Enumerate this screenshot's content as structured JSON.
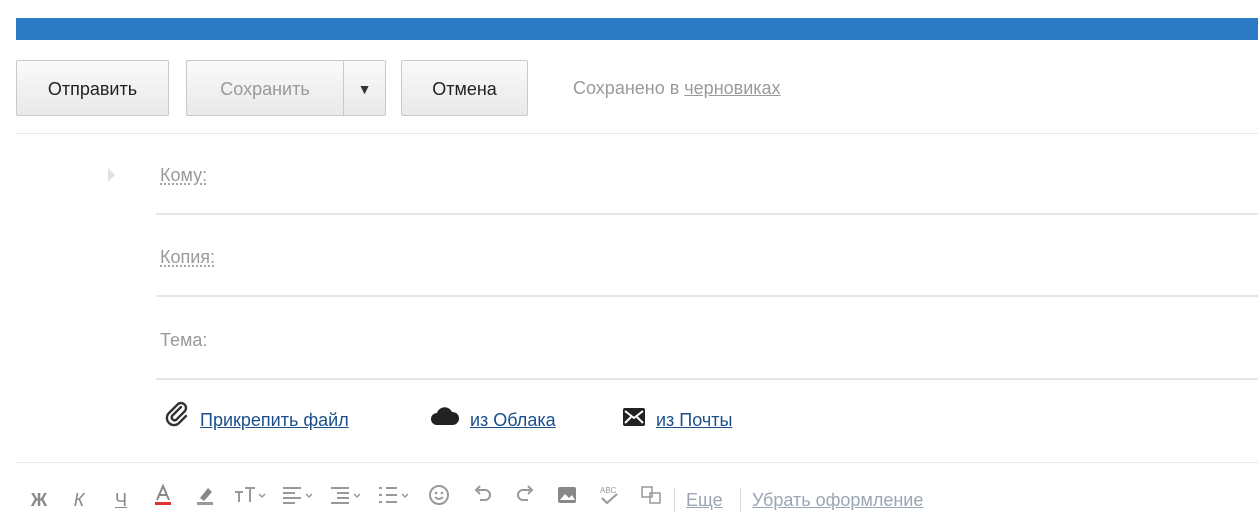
{
  "toolbar": {
    "send_label": "Отправить",
    "save_label": "Сохранить",
    "save_dropdown_glyph": "▼",
    "cancel_label": "Отмена",
    "status_prefix": "Сохранено в ",
    "status_link": "черновиках"
  },
  "fields": {
    "to_label": "Кому:",
    "cc_label": "Копия:",
    "subject_label": "Тема:"
  },
  "attachments": {
    "file_label": "Прикрепить файл",
    "cloud_label": "из Облака",
    "mail_label": "из Почты"
  },
  "format_bar": {
    "bold": "Ж",
    "italic": "К",
    "underline": "Ч",
    "more_label": "Еще",
    "clear_label": "Убрать оформление"
  },
  "colors": {
    "top_bar": "#2a7bc4",
    "link": "#1a4f8c"
  }
}
